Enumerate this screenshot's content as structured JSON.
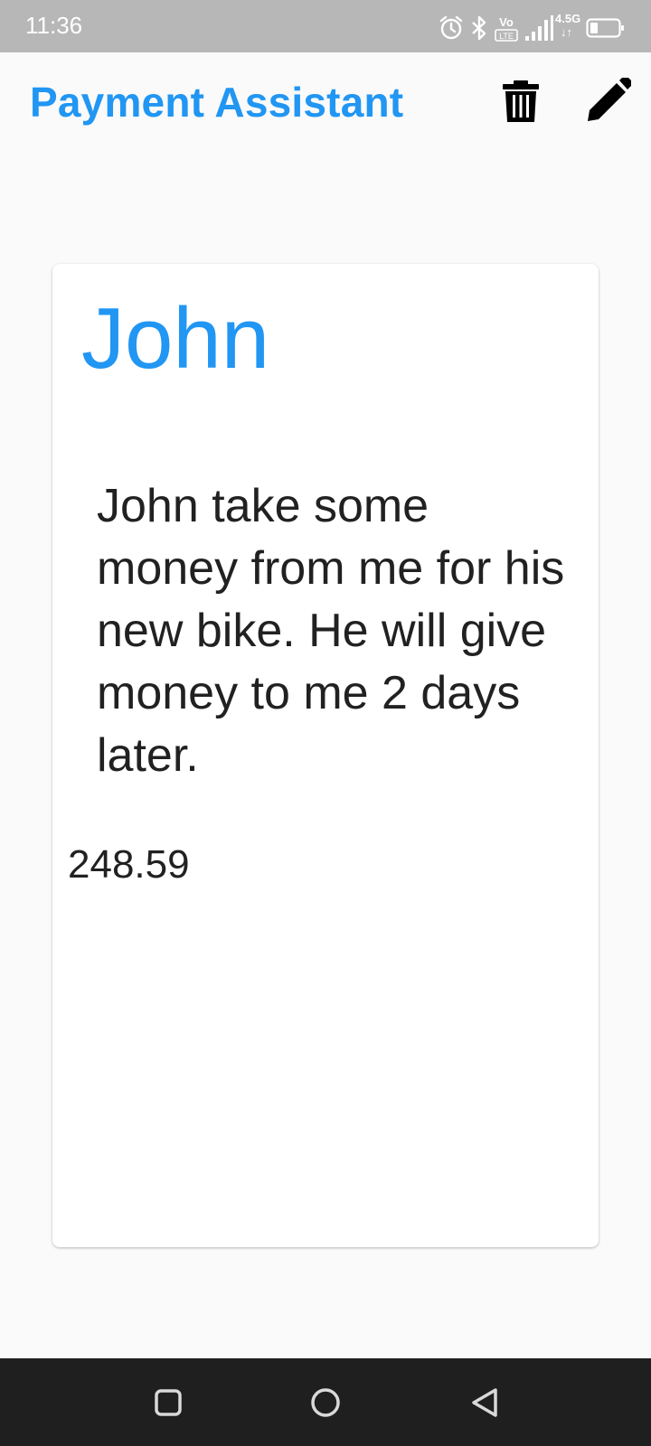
{
  "status_bar": {
    "time": "11:36",
    "network_label": "4.5G",
    "icons": [
      "alarm-icon",
      "bluetooth-icon",
      "volte-icon",
      "signal-icon",
      "data-icon",
      "battery-icon"
    ]
  },
  "app_bar": {
    "title": "Payment Assistant",
    "actions": [
      "delete-icon",
      "edit-icon"
    ]
  },
  "card": {
    "name": "John",
    "description": "John take some money from me for his new bike. He will give money to me 2 days later.",
    "amount": "248.59"
  },
  "nav_bar": {
    "buttons": [
      "recents-icon",
      "home-icon",
      "back-icon"
    ]
  },
  "colors": {
    "accent": "#2196f3",
    "status_bar": "#b7b7b7",
    "nav_bar": "#1f1f1f",
    "text": "#212121"
  }
}
